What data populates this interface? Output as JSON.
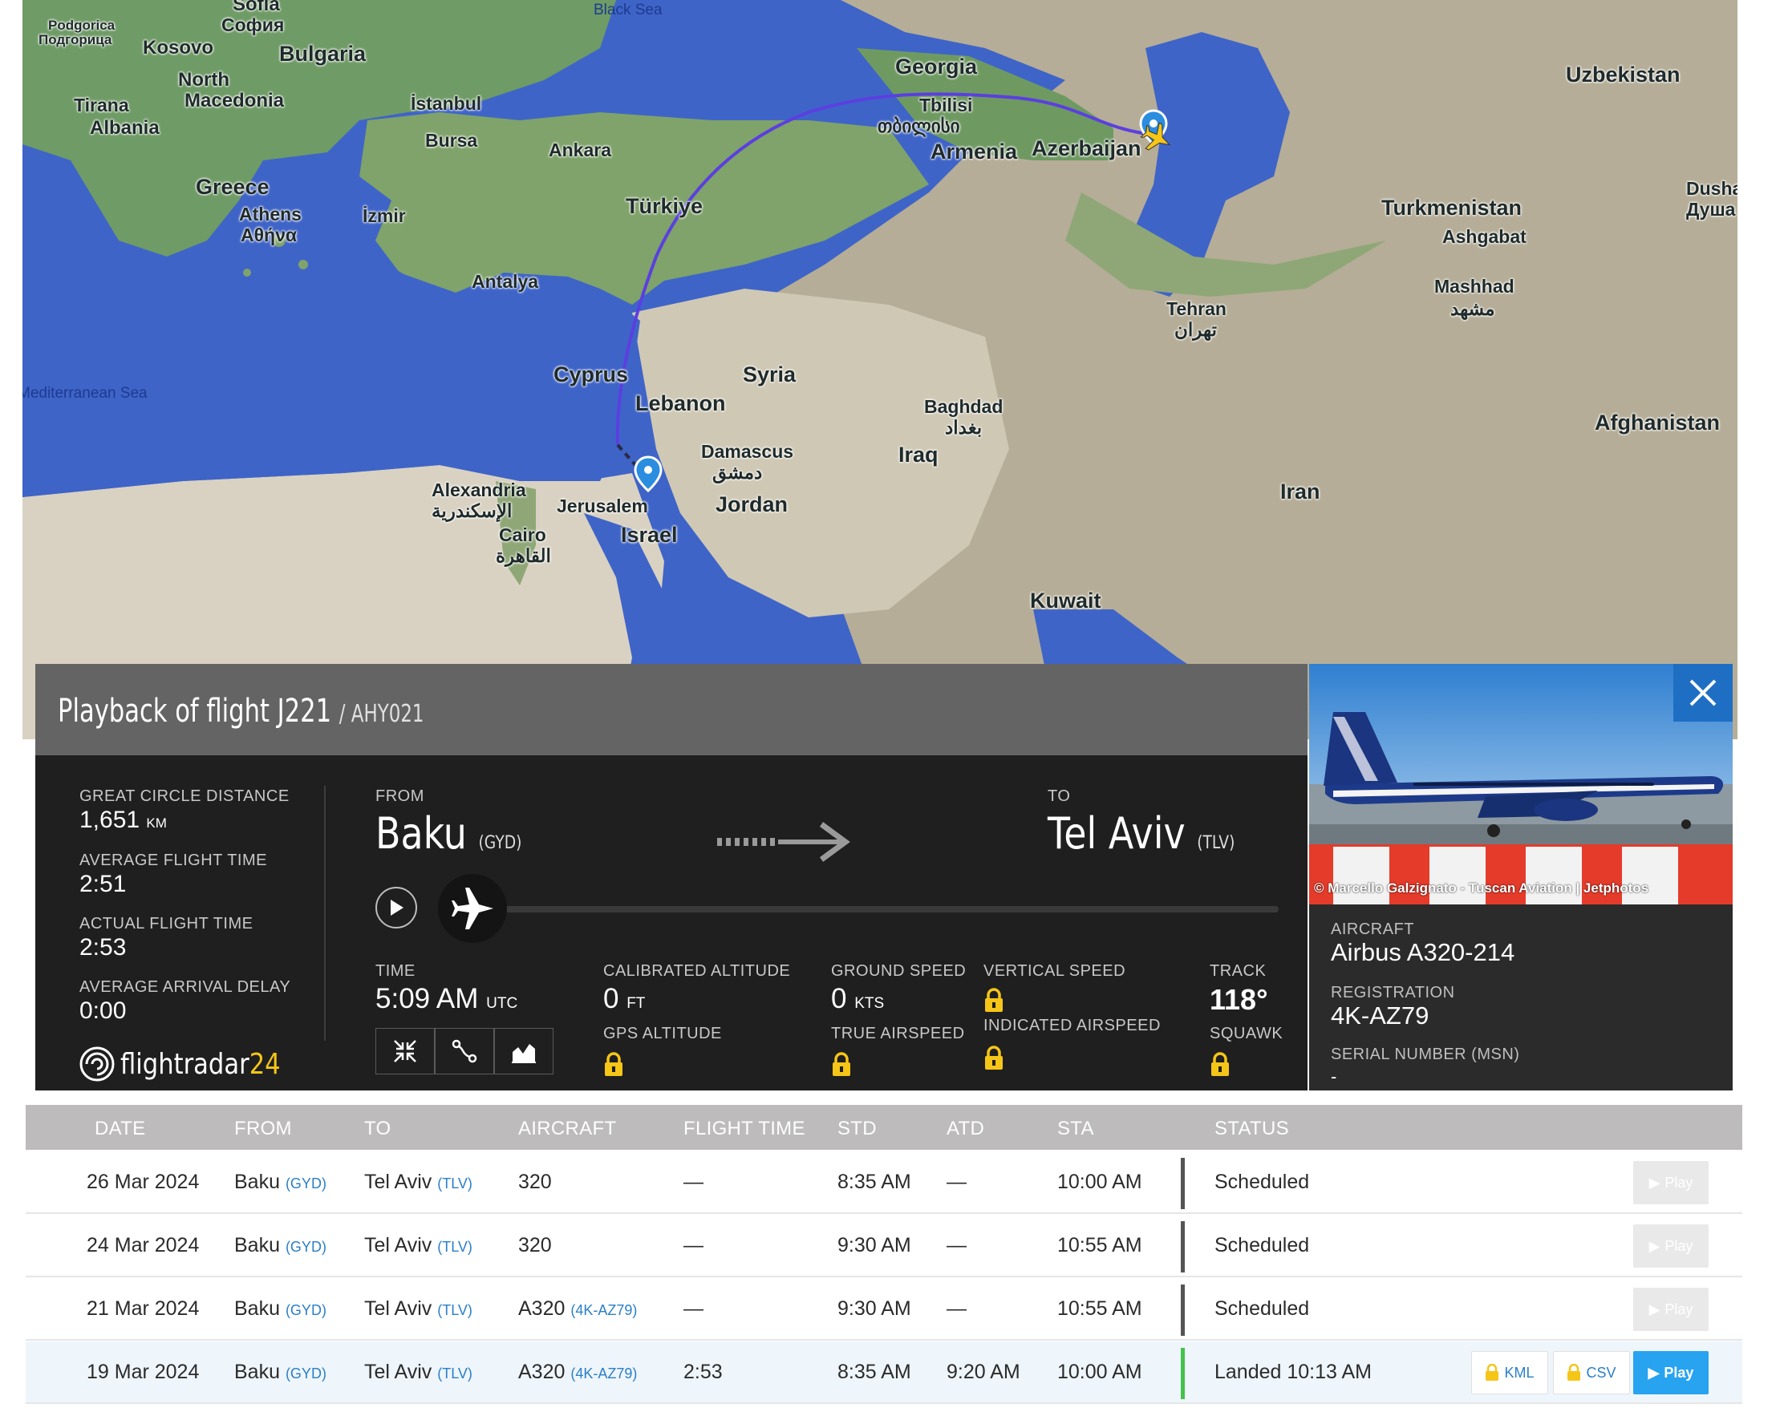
{
  "map": {
    "labels": {
      "black_sea": "Black Sea",
      "mediterranean_sea": "Mediterranean Sea",
      "sofia": "Sofia",
      "sofia_native": "София",
      "podgorica": "Podgorica",
      "podgorica_native": "Подгорица",
      "kosovo": "Kosovo",
      "bulgaria": "Bulgaria",
      "north_macedonia_1": "North",
      "north_macedonia_2": "Macedonia",
      "tirana": "Tirana",
      "albania": "Albania",
      "greece": "Greece",
      "athens": "Athens",
      "athens_native": "Αθήνα",
      "istanbul": "İstanbul",
      "bursa": "Bursa",
      "izmir": "İzmir",
      "ankara": "Ankara",
      "turkiye": "Türkiye",
      "antalya": "Antalya",
      "georgia": "Georgia",
      "tbilisi": "Tbilisi",
      "tbilisi_native": "თბილისი",
      "armenia": "Armenia",
      "azerbaijan": "Azerbaijan",
      "uzbekistan": "Uzbekistan",
      "turkmenistan": "Turkmenistan",
      "ashgabat": "Ashgabat",
      "dushanbe": "Dusha",
      "dushanbe_native": "Душа",
      "mashhad": "Mashhad",
      "mashhad_native": "مشهد",
      "tehran": "Tehran",
      "tehran_native": "تهران",
      "afghanistan": "Afghanistan",
      "iran": "Iran",
      "iraq": "Iraq",
      "baghdad": "Baghdad",
      "baghdad_native": "بغداد",
      "syria": "Syria",
      "lebanon": "Lebanon",
      "cyprus": "Cyprus",
      "damascus": "Damascus",
      "damascus_native": "دمشق",
      "jordan": "Jordan",
      "jerusalem": "Jerusalem",
      "israel": "Israel",
      "alexandria": "Alexandria",
      "alexandria_native": "الإسكندرية",
      "cairo": "Cairo",
      "cairo_native": "القاهرة",
      "kuwait": "Kuwait"
    }
  },
  "panel": {
    "title": "Playback of flight J221",
    "subtitle": "/ AHY021",
    "stats": {
      "great_circle_label": "GREAT CIRCLE DISTANCE",
      "great_circle_value": "1,651",
      "great_circle_unit": "KM",
      "avg_time_label": "AVERAGE FLIGHT TIME",
      "avg_time_value": "2:51",
      "actual_time_label": "ACTUAL FLIGHT TIME",
      "actual_time_value": "2:53",
      "avg_delay_label": "AVERAGE ARRIVAL DELAY",
      "avg_delay_value": "0:00"
    },
    "from_label": "FROM",
    "from_city": "Baku",
    "from_code": "(GYD)",
    "to_label": "TO",
    "to_city": "Tel Aviv",
    "to_code": "(TLV)",
    "playback_progress": 0,
    "time_label": "TIME",
    "time_value": "5:09 AM",
    "time_unit": "UTC",
    "calibrated_alt_label": "CALIBRATED ALTITUDE",
    "calibrated_alt_value": "0",
    "calibrated_alt_unit": "FT",
    "gps_alt_label": "GPS ALTITUDE",
    "ground_speed_label": "GROUND SPEED",
    "ground_speed_value": "0",
    "ground_speed_unit": "KTS",
    "true_airspeed_label": "TRUE AIRSPEED",
    "vertical_speed_label": "VERTICAL SPEED",
    "indicated_airspeed_label": "INDICATED AIRSPEED",
    "track_label": "TRACK",
    "track_value": "118°",
    "squawk_label": "SQUAWK",
    "logo_text": "flightradar",
    "logo_num": "24"
  },
  "aircraft": {
    "photo_credit": "© Marcello Galzignato - Tuscan Aviation | Jetphotos",
    "aircraft_label": "AIRCRAFT",
    "aircraft_value": "Airbus A320-214",
    "registration_label": "REGISTRATION",
    "registration_value": "4K-AZ79",
    "serial_label": "SERIAL NUMBER (MSN)",
    "serial_value": "-"
  },
  "table": {
    "headers": [
      "DATE",
      "FROM",
      "TO",
      "AIRCRAFT",
      "FLIGHT TIME",
      "STD",
      "ATD",
      "STA",
      "STATUS"
    ],
    "rows": [
      {
        "date": "26 Mar 2024",
        "from": "Baku",
        "from_code": "(GYD)",
        "to": "Tel Aviv",
        "to_code": "(TLV)",
        "aircraft": "320",
        "aircraft_reg": "",
        "flight_time": "—",
        "std": "8:35 AM",
        "atd": "—",
        "sta": "10:00 AM",
        "status": "Scheduled",
        "play": "Play"
      },
      {
        "date": "24 Mar 2024",
        "from": "Baku",
        "from_code": "(GYD)",
        "to": "Tel Aviv",
        "to_code": "(TLV)",
        "aircraft": "320",
        "aircraft_reg": "",
        "flight_time": "—",
        "std": "9:30 AM",
        "atd": "—",
        "sta": "10:55 AM",
        "status": "Scheduled",
        "play": "Play"
      },
      {
        "date": "21 Mar 2024",
        "from": "Baku",
        "from_code": "(GYD)",
        "to": "Tel Aviv",
        "to_code": "(TLV)",
        "aircraft": "A320",
        "aircraft_reg": "(4K-AZ79)",
        "flight_time": "—",
        "std": "9:30 AM",
        "atd": "—",
        "sta": "10:55 AM",
        "status": "Scheduled",
        "play": "Play"
      },
      {
        "date": "19 Mar 2024",
        "from": "Baku",
        "from_code": "(GYD)",
        "to": "Tel Aviv",
        "to_code": "(TLV)",
        "aircraft": "A320",
        "aircraft_reg": "(4K-AZ79)",
        "flight_time": "2:53",
        "std": "8:35 AM",
        "atd": "9:20 AM",
        "sta": "10:00 AM",
        "status": "Landed 10:13 AM",
        "play": "Play",
        "kml": "KML",
        "csv": "CSV"
      }
    ]
  },
  "colors": {
    "accent_blue": "#27a3f0",
    "close_blue": "#1e6fc4",
    "landed_green": "#44c24a",
    "lock_yellow": "#f5c518",
    "route_purple": "#5b3fe0"
  }
}
